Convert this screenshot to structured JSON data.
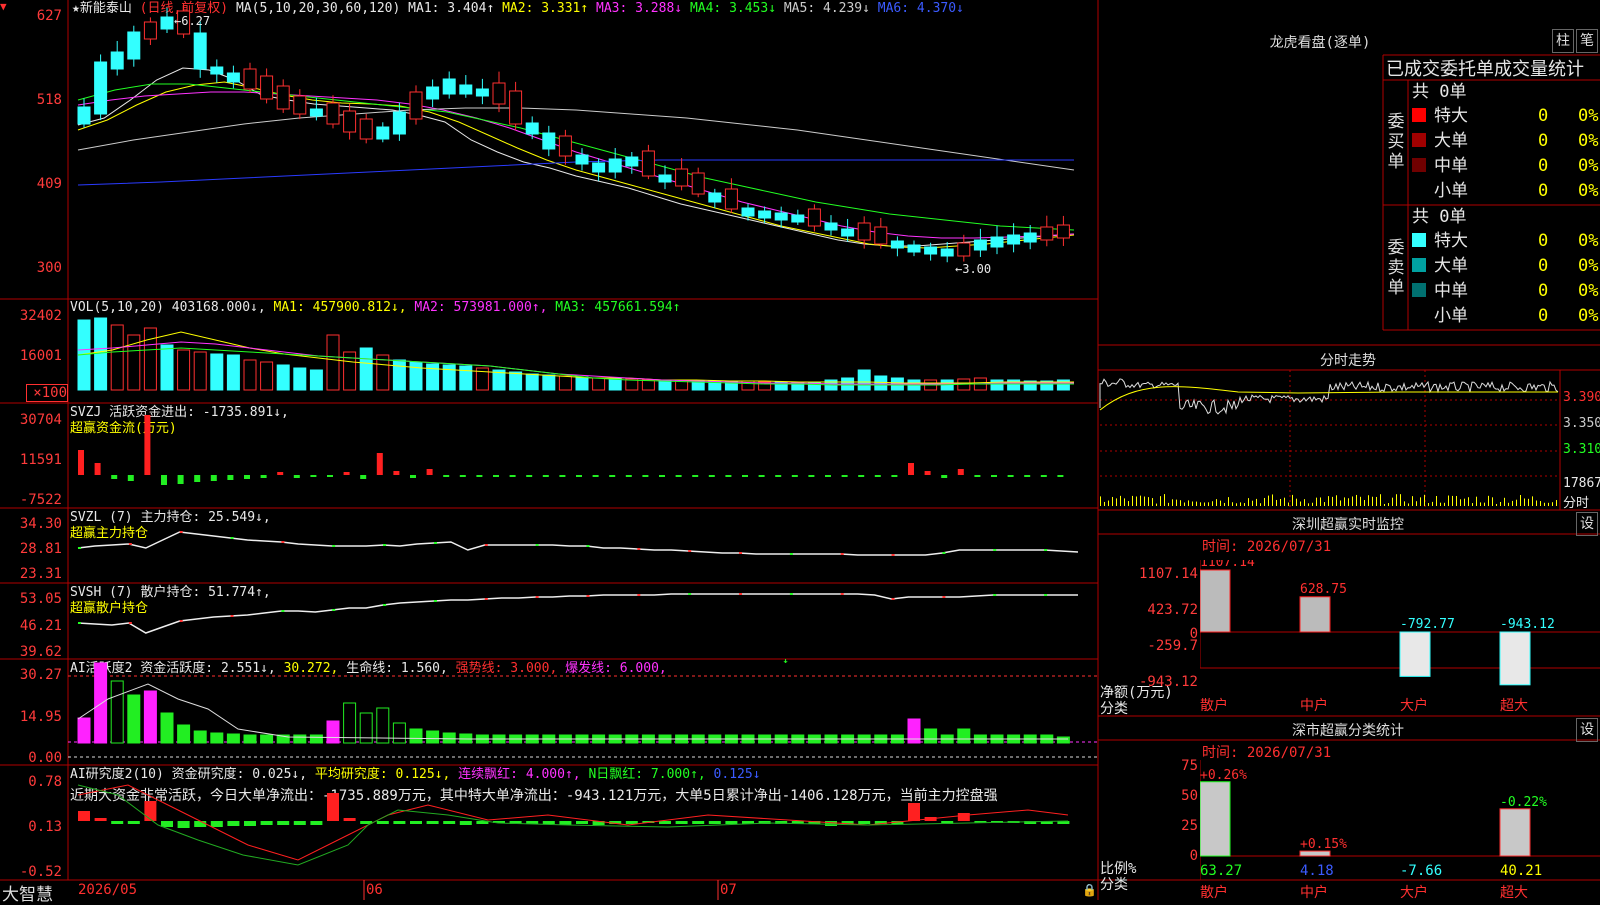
{
  "stock": {
    "title": "★新能泰山",
    "mode": "(日线,前复权)",
    "ma_label": "MA(5,10,20,30,60,120)",
    "ma": [
      {
        "text": "MA1: 3.404↑",
        "color": "#e8e8e8"
      },
      {
        "text": "MA2: 3.331↑",
        "color": "#ffff00"
      },
      {
        "text": "MA3: 3.288↓",
        "color": "#ff33ff"
      },
      {
        "text": "MA4: 3.453↓",
        "color": "#22ff22"
      },
      {
        "text": "MA5: 4.239↓",
        "color": "#cccccc"
      },
      {
        "text": "MA6: 4.370↓",
        "color": "#3b5bff"
      }
    ],
    "max_marker": "6.27",
    "min_marker": "3.00"
  },
  "price_axis": [
    "627",
    "518",
    "409",
    "300"
  ],
  "vol": {
    "header": [
      {
        "text": "VOL(5,10,20)",
        "color": "#e8e8e8"
      },
      {
        "text": "403168.000↓,",
        "color": "#e8e8e8"
      },
      {
        "text": "MA1: 457900.812↓,",
        "color": "#ffff00"
      },
      {
        "text": "MA2: 573981.000↑,",
        "color": "#ff33ff"
      },
      {
        "text": "MA3: 457661.594↑",
        "color": "#22ff22"
      }
    ],
    "axis": [
      "32402",
      "16001",
      "×100"
    ]
  },
  "svzj": {
    "line1": "SVZJ  活跃资金进出: -1735.891↓,",
    "line2": "超赢资金流(万元)",
    "axis": [
      "30704",
      "11591",
      "-7522"
    ]
  },
  "svzl": {
    "line1": "SVZL (7) 主力持仓: 25.549↓,",
    "line2": "超赢主力持仓",
    "axis": [
      "34.30",
      "28.81",
      "23.31"
    ]
  },
  "svsh": {
    "line1": "SVSH (7) 散户持仓: 51.774↑,",
    "line2": "超赢散户持仓",
    "axis": [
      "53.05",
      "46.21",
      "39.62"
    ]
  },
  "ai1": {
    "header": [
      {
        "text": "AI活跃度2 资金活跃度: 2.551↓,",
        "color": "#e8e8e8"
      },
      {
        "text": "30.272,",
        "color": "#ffff00"
      },
      {
        "text": "生命线: 1.560,",
        "color": "#e8e8e8"
      },
      {
        "text": "强势线: 3.000,",
        "color": "#ff3030"
      },
      {
        "text": "爆发线: 6.000,",
        "color": "#ff33ff"
      }
    ],
    "axis": [
      "30.27",
      "14.95",
      "0.00"
    ]
  },
  "ai2": {
    "header": [
      {
        "text": "AI研究度2(10) 资金研究度: 0.025↓,",
        "color": "#e8e8e8"
      },
      {
        "text": "平均研究度: 0.125↓,",
        "color": "#ffff00"
      },
      {
        "text": "连续飘红: 4.000↑,",
        "color": "#ff33ff"
      },
      {
        "text": "N日飘红: 7.000↑,",
        "color": "#22ff22"
      },
      {
        "text": "0.125↓",
        "color": "#3b5bff"
      }
    ],
    "comment": "近期大资金非常活跃，今日大单净流出：-1735.889万元，其中特大单净流出：-943.121万元，大单5日累计净出-1406.128万元，当前主力控盘强",
    "axis": [
      "0.78",
      "0.13",
      "-0.52"
    ]
  },
  "footer": {
    "brand": "大智慧",
    "dates": [
      "2026/05",
      "06",
      "07"
    ]
  },
  "right": {
    "lhkp_title": "龙虎看盘(逐单)",
    "btn_zhu": "柱",
    "btn_bi": "笔",
    "table_header": "已成交委托单成交量统计",
    "buy_label": [
      "委",
      "买",
      "单"
    ],
    "sell_label": [
      "委",
      "卖",
      "单"
    ],
    "buy_total": "共 0单",
    "sell_total": "共 0单",
    "buy_rows": [
      {
        "name": "特大",
        "val": "0",
        "pct": "0%",
        "color": "#ff0000"
      },
      {
        "name": "大单",
        "val": "0",
        "pct": "0%",
        "color": "#a00000"
      },
      {
        "name": "中单",
        "val": "0",
        "pct": "0%",
        "color": "#700000"
      },
      {
        "name": "小单",
        "val": "0",
        "pct": "0%",
        "color": "#000000"
      }
    ],
    "sell_rows": [
      {
        "name": "特大",
        "val": "0",
        "pct": "0%",
        "color": "#33ffff"
      },
      {
        "name": "大单",
        "val": "0",
        "pct": "0%",
        "color": "#00a0a0"
      },
      {
        "name": "中单",
        "val": "0",
        "pct": "0%",
        "color": "#007070"
      },
      {
        "name": "小单",
        "val": "0",
        "pct": "0%",
        "color": "#000000"
      }
    ],
    "intraday_title": "分时走势",
    "intraday_axis": [
      "3.390",
      "3.350",
      "3.310",
      "17867",
      "分时"
    ],
    "sz_monitor_title": "深圳超赢实时监控",
    "sz_monitor_btn": "设",
    "time1": "时间: 2026/07/31",
    "monitor_axis": [
      "1107.14",
      "423.72",
      "0",
      "-259.7",
      "-943.12"
    ],
    "monitor_units": "净额(万元)",
    "monitor_cat": "分类",
    "monitor_values": [
      {
        "cat": "散户",
        "value": 1107.14,
        "label": "1107.14"
      },
      {
        "cat": "中户",
        "value": 628.75,
        "label": "628.75"
      },
      {
        "cat": "大户",
        "value": -792.77,
        "label": "-792.77"
      },
      {
        "cat": "超大",
        "value": -943.12,
        "label": "-943.12"
      }
    ],
    "sz_class_title": "深市超赢分类统计",
    "sz_class_btn": "设",
    "time2": "时间: 2026/07/31",
    "class_axis": [
      "75",
      "50",
      "25",
      "0"
    ],
    "class_units": "比例%",
    "class_cat": "分类",
    "class_values": [
      {
        "cat": "散户",
        "pct": "+0.26%",
        "ratio": 63.27,
        "label": "63.27",
        "color": "#22ff22"
      },
      {
        "cat": "中户",
        "pct": "+0.15%",
        "ratio": 4.18,
        "label": "4.18",
        "color": "#3b5bff"
      },
      {
        "cat": "大户",
        "pct": "",
        "ratio": -7.66,
        "label": "-7.66",
        "color": "#33ffff"
      },
      {
        "cat": "超大",
        "pct": "-0.22%",
        "ratio": 40.21,
        "label": "40.21",
        "color": "#ffff00"
      }
    ],
    "class_cat_labels": [
      "散户",
      "中户",
      "大户",
      "超大"
    ]
  }
}
